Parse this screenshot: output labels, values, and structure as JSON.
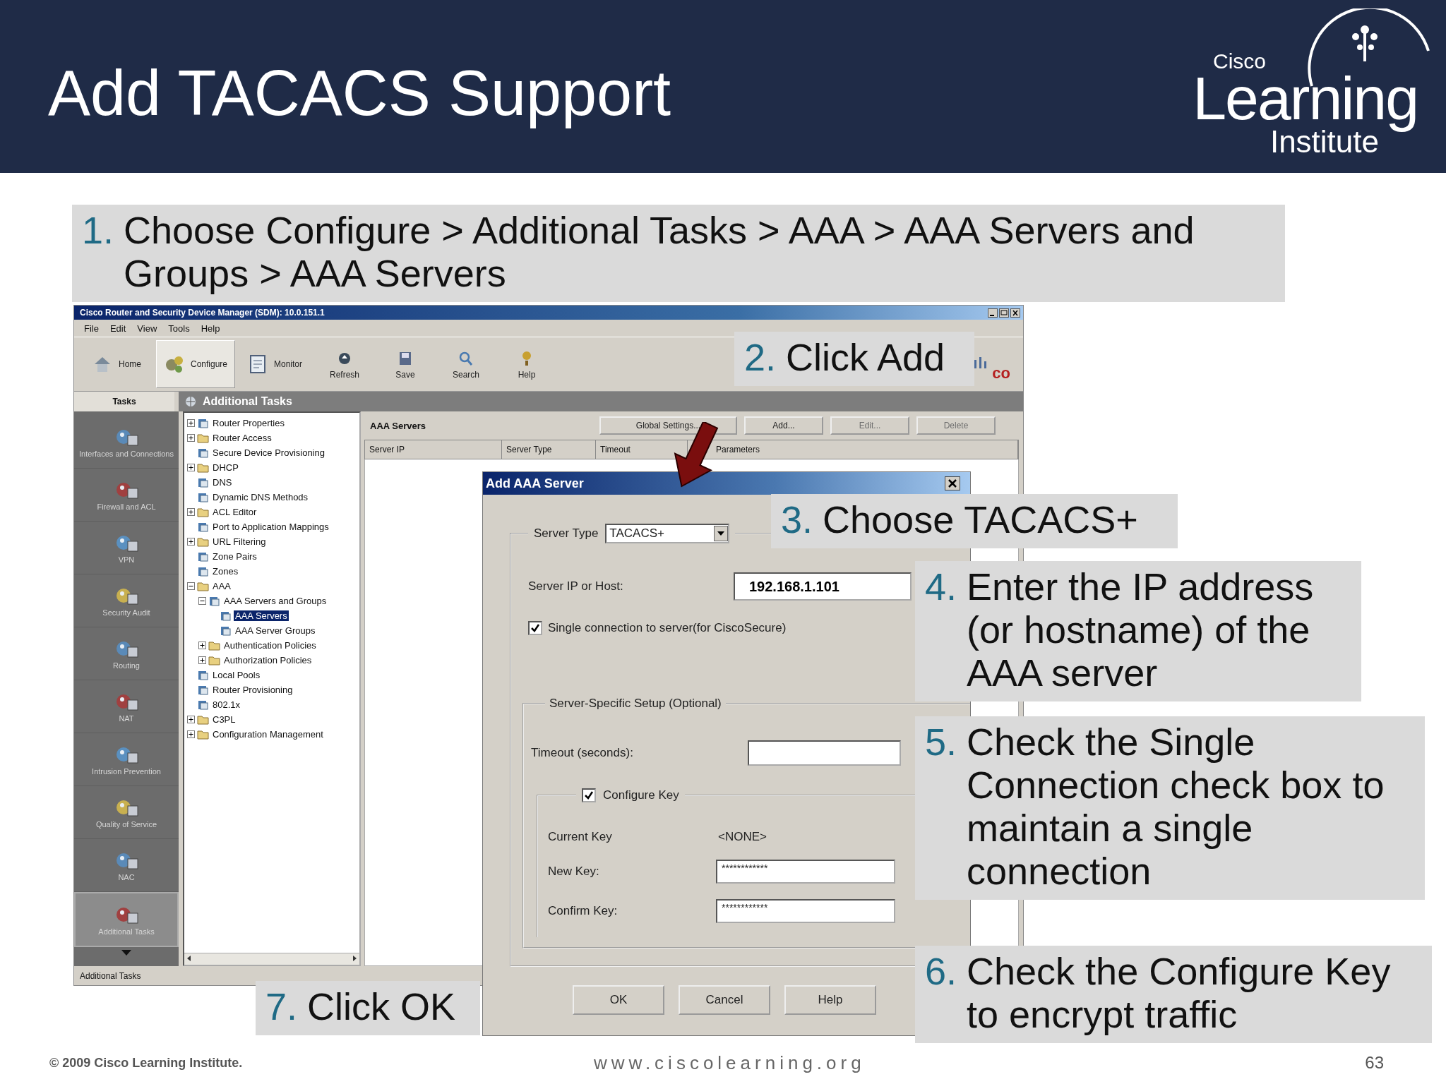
{
  "slide": {
    "title": "Add TACACS Support",
    "logo": {
      "top": "Cisco",
      "main": "Learning",
      "bottom": "Institute"
    },
    "footer": {
      "copyright": "© 2009 Cisco Learning Institute.",
      "url": "www.ciscolearning.org",
      "page": "63"
    }
  },
  "callouts": [
    {
      "number": "1.",
      "text": "Choose Configure > Additional Tasks > AAA > AAA Servers and Groups > AAA Servers"
    },
    {
      "number": "2.",
      "text": "Click Add"
    },
    {
      "number": "3.",
      "text": "Choose TACACS+"
    },
    {
      "number": "4.",
      "text": "Enter the IP address (or hostname) of the AAA server"
    },
    {
      "number": "5.",
      "text": "Check the Single Connection check box to maintain a single connection"
    },
    {
      "number": "7.",
      "text": "Click OK"
    },
    {
      "number": "6.",
      "text": "Check the Configure Key to encrypt traffic"
    }
  ],
  "app": {
    "title": "Cisco Router and Security Device Manager (SDM): 10.0.151.1",
    "menu": [
      "File",
      "Edit",
      "View",
      "Tools",
      "Help"
    ],
    "toolbar": [
      {
        "label": "Home",
        "selected": false
      },
      {
        "label": "Configure",
        "selected": true
      },
      {
        "label": "Monitor",
        "selected": false
      },
      {
        "label": "Refresh",
        "selected": false
      },
      {
        "label": "Save",
        "selected": false
      },
      {
        "label": "Search",
        "selected": false
      },
      {
        "label": "Help",
        "selected": false
      }
    ],
    "logo_fragment": "co",
    "tasks_tab": "Tasks",
    "panel_title": "Additional Tasks",
    "tasks": [
      {
        "label": "Interfaces and Connections",
        "selected": false
      },
      {
        "label": "Firewall and ACL",
        "selected": false
      },
      {
        "label": "VPN",
        "selected": false
      },
      {
        "label": "Security Audit",
        "selected": false
      },
      {
        "label": "Routing",
        "selected": false
      },
      {
        "label": "NAT",
        "selected": false
      },
      {
        "label": "Intrusion Prevention",
        "selected": false
      },
      {
        "label": "Quality of Service",
        "selected": false
      },
      {
        "label": "NAC",
        "selected": false
      },
      {
        "label": "Additional Tasks",
        "selected": true
      }
    ],
    "tree": [
      {
        "label": "Router Properties",
        "kind": "page",
        "expandable": true,
        "expanded": false,
        "selected": false
      },
      {
        "label": "Router Access",
        "kind": "folder",
        "expandable": true,
        "expanded": false,
        "selected": false
      },
      {
        "label": "Secure Device Provisioning",
        "kind": "page",
        "expandable": false,
        "selected": false
      },
      {
        "label": "DHCP",
        "kind": "folder",
        "expandable": true,
        "expanded": false,
        "selected": false
      },
      {
        "label": "DNS",
        "kind": "page",
        "expandable": false,
        "selected": false
      },
      {
        "label": "Dynamic DNS Methods",
        "kind": "page",
        "expandable": false,
        "selected": false
      },
      {
        "label": "ACL Editor",
        "kind": "folder",
        "expandable": true,
        "expanded": false,
        "selected": false
      },
      {
        "label": "Port to Application Mappings",
        "kind": "page",
        "expandable": false,
        "selected": false
      },
      {
        "label": "URL Filtering",
        "kind": "folder",
        "expandable": true,
        "expanded": false,
        "selected": false
      },
      {
        "label": "Zone Pairs",
        "kind": "page",
        "expandable": false,
        "selected": false
      },
      {
        "label": "Zones",
        "kind": "page",
        "expandable": false,
        "selected": false
      },
      {
        "label": "AAA",
        "kind": "folder",
        "expandable": true,
        "expanded": true,
        "selected": false,
        "children": [
          {
            "label": "AAA Servers and Groups",
            "kind": "page",
            "expandable": true,
            "expanded": true,
            "selected": false,
            "children": [
              {
                "label": "AAA Servers",
                "kind": "page",
                "expandable": false,
                "selected": true
              },
              {
                "label": "AAA Server Groups",
                "kind": "page",
                "expandable": false,
                "selected": false
              }
            ]
          },
          {
            "label": "Authentication Policies",
            "kind": "folder",
            "expandable": true,
            "expanded": false,
            "selected": false
          },
          {
            "label": "Authorization Policies",
            "kind": "folder",
            "expandable": true,
            "expanded": false,
            "selected": false
          }
        ]
      },
      {
        "label": "Local Pools",
        "kind": "page",
        "expandable": false,
        "selected": false
      },
      {
        "label": "Router Provisioning",
        "kind": "page",
        "expandable": false,
        "selected": false
      },
      {
        "label": "802.1x",
        "kind": "page",
        "expandable": false,
        "selected": false
      },
      {
        "label": "C3PL",
        "kind": "folder",
        "expandable": true,
        "expanded": false,
        "selected": false
      },
      {
        "label": "Configuration Management",
        "kind": "folder",
        "expandable": true,
        "expanded": false,
        "selected": false
      }
    ],
    "section_title": "AAA Servers",
    "buttons": [
      {
        "label": "Global Settings...",
        "disabled": false
      },
      {
        "label": "Add...",
        "disabled": false
      },
      {
        "label": "Edit...",
        "disabled": true
      },
      {
        "label": "Delete",
        "disabled": true
      }
    ],
    "columns": [
      "Server IP",
      "Server Type",
      "Timeout",
      "Parameters"
    ],
    "status": "Additional Tasks"
  },
  "dialog": {
    "title": "Add AAA Server",
    "server_type": {
      "label": "Server Type",
      "value": "TACACS+"
    },
    "server_ip": {
      "label": "Server IP or Host:",
      "value": "192.168.1.101"
    },
    "single_connection": {
      "label": "Single connection to server(for CiscoSecure)",
      "checked": true
    },
    "setup_group": "Server-Specific Setup (Optional)",
    "timeout": {
      "label": "Timeout (seconds):"
    },
    "configure_key": {
      "label": "Configure Key",
      "checked": true
    },
    "current_key": {
      "label": "Current Key",
      "value": "<NONE>"
    },
    "new_key": {
      "label": "New Key:",
      "value": "************"
    },
    "confirm_key": {
      "label": "Confirm Key:",
      "value": "************"
    },
    "buttons": [
      "OK",
      "Cancel",
      "Help"
    ]
  }
}
